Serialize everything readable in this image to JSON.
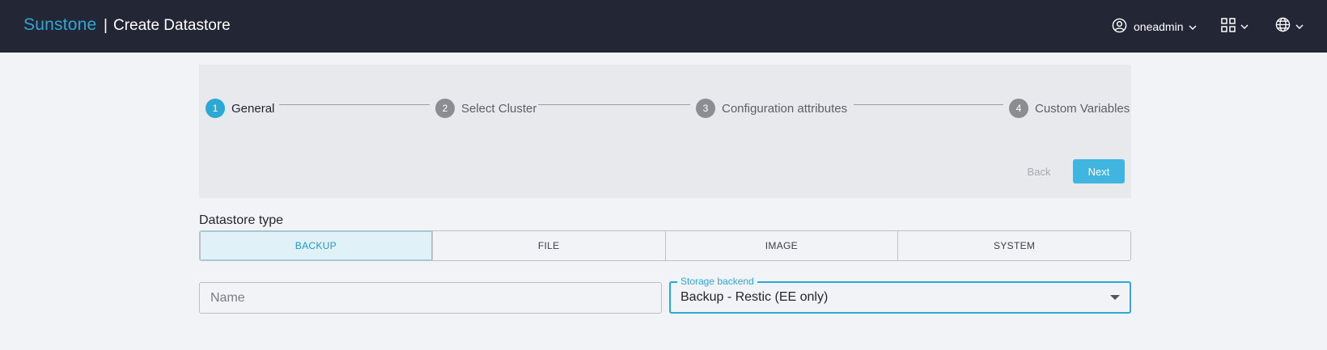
{
  "header": {
    "brand": "Sunstone",
    "separator": "|",
    "title": "Create Datastore",
    "user": "oneadmin"
  },
  "stepper": {
    "steps": [
      {
        "number": "1",
        "label": "General",
        "active": true
      },
      {
        "number": "2",
        "label": "Select Cluster",
        "active": false
      },
      {
        "number": "3",
        "label": "Configuration attributes",
        "active": false
      },
      {
        "number": "4",
        "label": "Custom Variables",
        "active": false
      }
    ],
    "back_label": "Back",
    "next_label": "Next"
  },
  "form": {
    "datastore_type_label": "Datastore type",
    "types": [
      {
        "label": "BACKUP",
        "selected": true
      },
      {
        "label": "FILE",
        "selected": false
      },
      {
        "label": "IMAGE",
        "selected": false
      },
      {
        "label": "SYSTEM",
        "selected": false
      }
    ],
    "name": {
      "value": "",
      "placeholder": "Name"
    },
    "storage_backend": {
      "label": "Storage backend",
      "value": "Backup - Restic (EE only)"
    }
  },
  "colors": {
    "topbar": "#232735",
    "accent": "#2aa8d6",
    "primary_button": "#40b5df",
    "background": "#f2f3f6"
  },
  "icons": [
    "user-circle-icon",
    "chevron-down-icon",
    "apps-grid-icon",
    "globe-icon"
  ]
}
